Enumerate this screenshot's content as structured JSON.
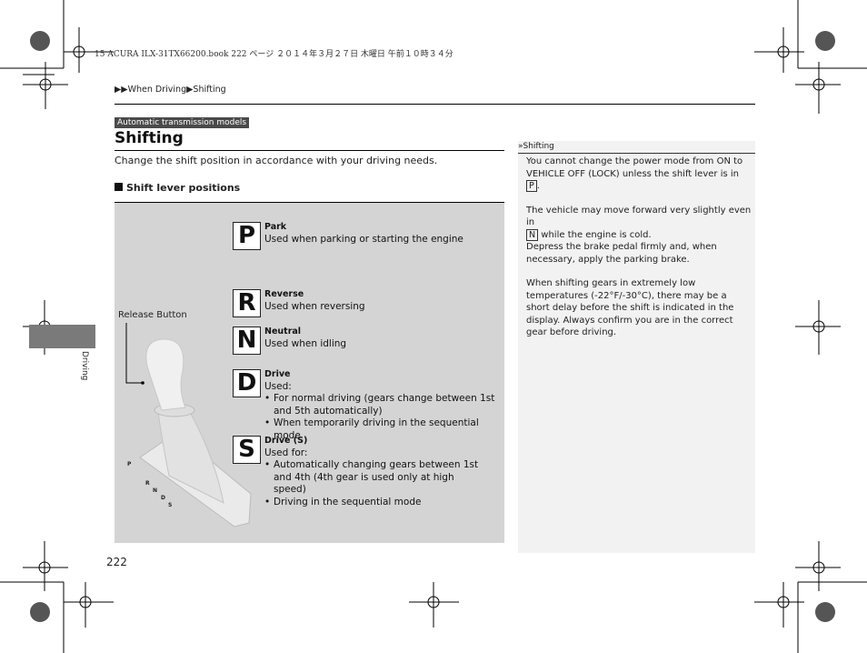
{
  "print_slug": "15 ACURA ILX-31TX66200.book  222 ページ  ２０１４年３月２７日  木曜日  午前１０時３４分",
  "breadcrumb": {
    "prefix": "▶▶",
    "items": [
      "When Driving",
      "Shifting"
    ],
    "separator": "▶"
  },
  "model_tag": "Automatic transmission models",
  "title": "Shifting",
  "intro": "Change the shift position in accordance with your driving needs.",
  "subsection": "Shift lever positions",
  "diagram": {
    "release_label": "Release Button",
    "lever_letters": [
      "P",
      "R",
      "N",
      "D",
      "S"
    ],
    "gears": [
      {
        "letter": "P",
        "name": "Park",
        "desc": "Used when parking or starting the engine",
        "bullets": []
      },
      {
        "letter": "R",
        "name": "Reverse",
        "desc": "Used when reversing",
        "bullets": []
      },
      {
        "letter": "N",
        "name": "Neutral",
        "desc": "Used when idling",
        "bullets": []
      },
      {
        "letter": "D",
        "name": "Drive",
        "desc": "Used:",
        "bullets": [
          "For normal driving (gears change between 1st and 5th automatically)",
          "When temporarily driving in the sequential mode"
        ]
      },
      {
        "letter": "S",
        "name": "Drive (S)",
        "desc": "Used for:",
        "bullets": [
          "Automatically changing gears between 1st and 4th (4th gear is used only at high speed)",
          "Driving in the sequential mode"
        ]
      }
    ]
  },
  "side_note": {
    "header_icon": "»",
    "header": "Shifting",
    "p1a": "You cannot change the power mode from ON to VEHICLE OFF (LOCK) unless the shift lever is in ",
    "p1box": "P",
    "p1b": ".",
    "p2box": "N",
    "p2a": " while the engine is cold.",
    "p2pre": "The vehicle may move forward very slightly even in",
    "p3": "Depress the brake pedal firmly and, when necessary, apply the parking brake.",
    "p4": "When shifting gears in extremely low temperatures (-22°F/-30°C), there may be a short delay before the shift is indicated in the display. Always confirm you are in the correct gear before driving."
  },
  "side_tab": "Driving",
  "page_number": "222"
}
